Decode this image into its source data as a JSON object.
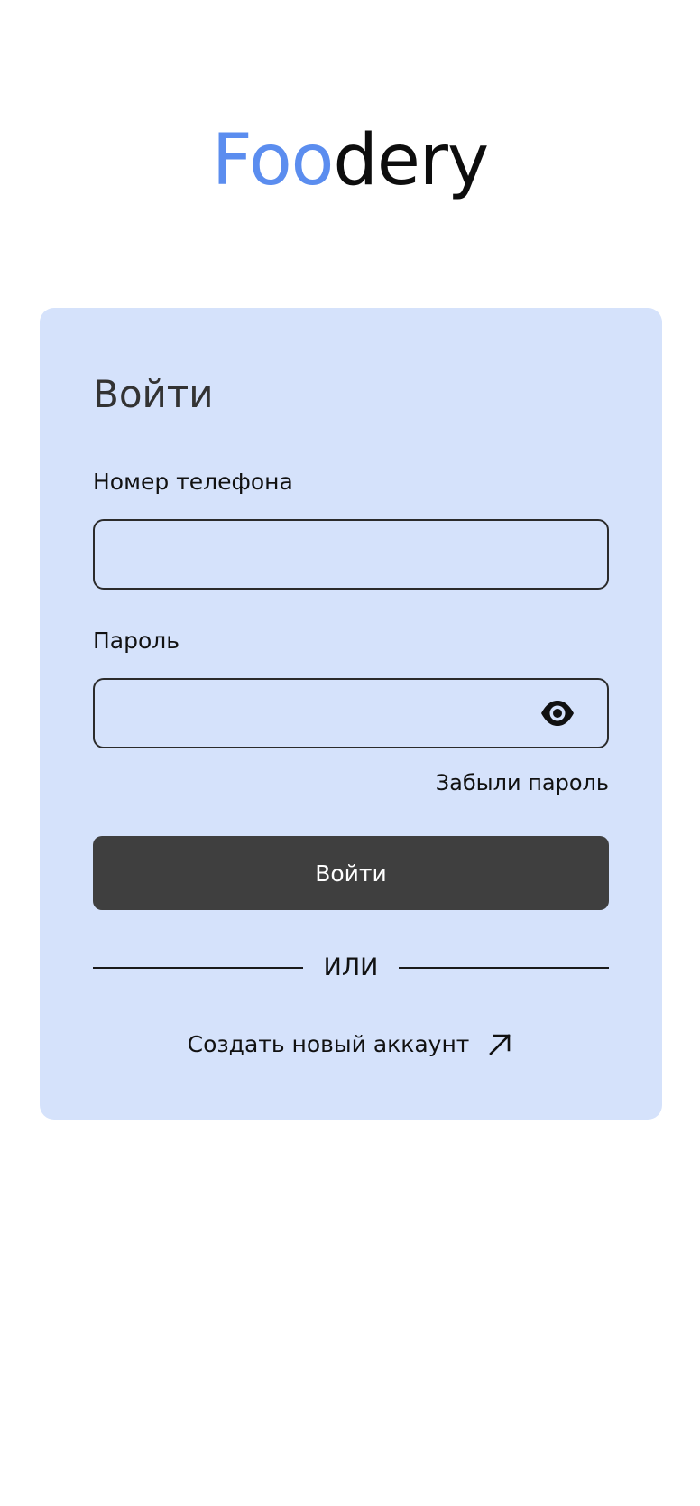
{
  "logo": {
    "part_a": "Foo",
    "part_b": "dery"
  },
  "login": {
    "title": "Войти",
    "phone_label": "Номер телефона",
    "phone_value": "",
    "password_label": "Пароль",
    "password_value": "",
    "forgot_link": "Забыли пароль",
    "submit_label": "Войти",
    "divider_text": "ИЛИ",
    "create_account_label": "Создать новый аккаунт"
  },
  "icons": {
    "password_toggle": "eye-icon",
    "create_account": "arrow-up-right-icon"
  },
  "colors": {
    "brand_blue": "#5b8def",
    "card_background": "#d5e2fb",
    "button_background": "#3f3f3f"
  }
}
